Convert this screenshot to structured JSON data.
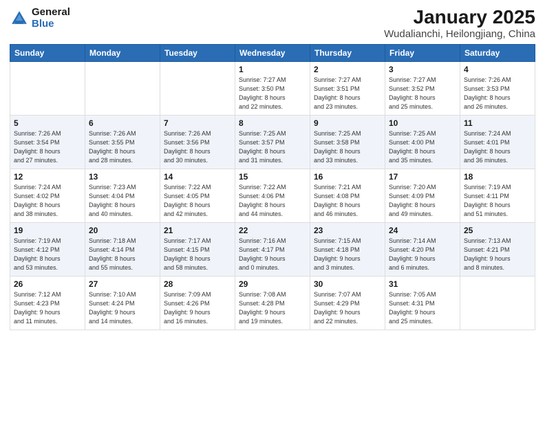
{
  "header": {
    "logo_general": "General",
    "logo_blue": "Blue",
    "title": "January 2025",
    "subtitle": "Wudalianchi, Heilongjiang, China"
  },
  "weekdays": [
    "Sunday",
    "Monday",
    "Tuesday",
    "Wednesday",
    "Thursday",
    "Friday",
    "Saturday"
  ],
  "weeks": [
    [
      {
        "day": "",
        "info": ""
      },
      {
        "day": "",
        "info": ""
      },
      {
        "day": "",
        "info": ""
      },
      {
        "day": "1",
        "info": "Sunrise: 7:27 AM\nSunset: 3:50 PM\nDaylight: 8 hours\nand 22 minutes."
      },
      {
        "day": "2",
        "info": "Sunrise: 7:27 AM\nSunset: 3:51 PM\nDaylight: 8 hours\nand 23 minutes."
      },
      {
        "day": "3",
        "info": "Sunrise: 7:27 AM\nSunset: 3:52 PM\nDaylight: 8 hours\nand 25 minutes."
      },
      {
        "day": "4",
        "info": "Sunrise: 7:26 AM\nSunset: 3:53 PM\nDaylight: 8 hours\nand 26 minutes."
      }
    ],
    [
      {
        "day": "5",
        "info": "Sunrise: 7:26 AM\nSunset: 3:54 PM\nDaylight: 8 hours\nand 27 minutes."
      },
      {
        "day": "6",
        "info": "Sunrise: 7:26 AM\nSunset: 3:55 PM\nDaylight: 8 hours\nand 28 minutes."
      },
      {
        "day": "7",
        "info": "Sunrise: 7:26 AM\nSunset: 3:56 PM\nDaylight: 8 hours\nand 30 minutes."
      },
      {
        "day": "8",
        "info": "Sunrise: 7:25 AM\nSunset: 3:57 PM\nDaylight: 8 hours\nand 31 minutes."
      },
      {
        "day": "9",
        "info": "Sunrise: 7:25 AM\nSunset: 3:58 PM\nDaylight: 8 hours\nand 33 minutes."
      },
      {
        "day": "10",
        "info": "Sunrise: 7:25 AM\nSunset: 4:00 PM\nDaylight: 8 hours\nand 35 minutes."
      },
      {
        "day": "11",
        "info": "Sunrise: 7:24 AM\nSunset: 4:01 PM\nDaylight: 8 hours\nand 36 minutes."
      }
    ],
    [
      {
        "day": "12",
        "info": "Sunrise: 7:24 AM\nSunset: 4:02 PM\nDaylight: 8 hours\nand 38 minutes."
      },
      {
        "day": "13",
        "info": "Sunrise: 7:23 AM\nSunset: 4:04 PM\nDaylight: 8 hours\nand 40 minutes."
      },
      {
        "day": "14",
        "info": "Sunrise: 7:22 AM\nSunset: 4:05 PM\nDaylight: 8 hours\nand 42 minutes."
      },
      {
        "day": "15",
        "info": "Sunrise: 7:22 AM\nSunset: 4:06 PM\nDaylight: 8 hours\nand 44 minutes."
      },
      {
        "day": "16",
        "info": "Sunrise: 7:21 AM\nSunset: 4:08 PM\nDaylight: 8 hours\nand 46 minutes."
      },
      {
        "day": "17",
        "info": "Sunrise: 7:20 AM\nSunset: 4:09 PM\nDaylight: 8 hours\nand 49 minutes."
      },
      {
        "day": "18",
        "info": "Sunrise: 7:19 AM\nSunset: 4:11 PM\nDaylight: 8 hours\nand 51 minutes."
      }
    ],
    [
      {
        "day": "19",
        "info": "Sunrise: 7:19 AM\nSunset: 4:12 PM\nDaylight: 8 hours\nand 53 minutes."
      },
      {
        "day": "20",
        "info": "Sunrise: 7:18 AM\nSunset: 4:14 PM\nDaylight: 8 hours\nand 55 minutes."
      },
      {
        "day": "21",
        "info": "Sunrise: 7:17 AM\nSunset: 4:15 PM\nDaylight: 8 hours\nand 58 minutes."
      },
      {
        "day": "22",
        "info": "Sunrise: 7:16 AM\nSunset: 4:17 PM\nDaylight: 9 hours\nand 0 minutes."
      },
      {
        "day": "23",
        "info": "Sunrise: 7:15 AM\nSunset: 4:18 PM\nDaylight: 9 hours\nand 3 minutes."
      },
      {
        "day": "24",
        "info": "Sunrise: 7:14 AM\nSunset: 4:20 PM\nDaylight: 9 hours\nand 6 minutes."
      },
      {
        "day": "25",
        "info": "Sunrise: 7:13 AM\nSunset: 4:21 PM\nDaylight: 9 hours\nand 8 minutes."
      }
    ],
    [
      {
        "day": "26",
        "info": "Sunrise: 7:12 AM\nSunset: 4:23 PM\nDaylight: 9 hours\nand 11 minutes."
      },
      {
        "day": "27",
        "info": "Sunrise: 7:10 AM\nSunset: 4:24 PM\nDaylight: 9 hours\nand 14 minutes."
      },
      {
        "day": "28",
        "info": "Sunrise: 7:09 AM\nSunset: 4:26 PM\nDaylight: 9 hours\nand 16 minutes."
      },
      {
        "day": "29",
        "info": "Sunrise: 7:08 AM\nSunset: 4:28 PM\nDaylight: 9 hours\nand 19 minutes."
      },
      {
        "day": "30",
        "info": "Sunrise: 7:07 AM\nSunset: 4:29 PM\nDaylight: 9 hours\nand 22 minutes."
      },
      {
        "day": "31",
        "info": "Sunrise: 7:05 AM\nSunset: 4:31 PM\nDaylight: 9 hours\nand 25 minutes."
      },
      {
        "day": "",
        "info": ""
      }
    ]
  ]
}
